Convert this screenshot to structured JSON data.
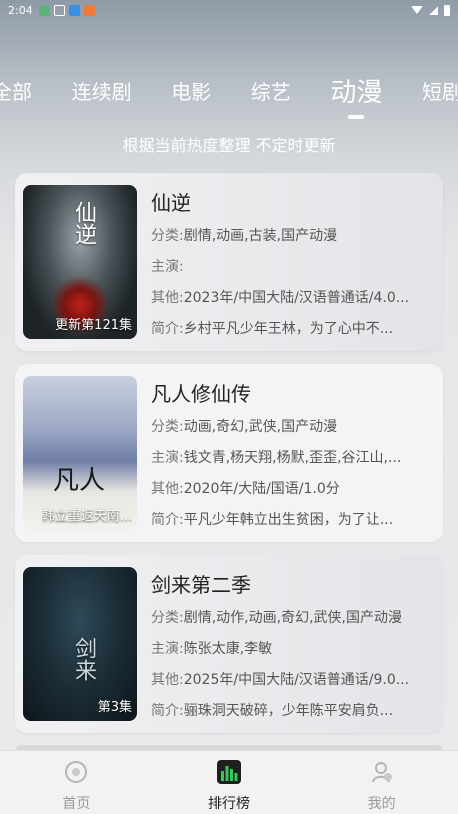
{
  "status": {
    "time": "2:04"
  },
  "tabs": [
    "全部",
    "连续剧",
    "电影",
    "综艺",
    "动漫",
    "短剧"
  ],
  "active_tab": "动漫",
  "subtitle": "根据当前热度整理 不定时更新",
  "labels": {
    "category": "分类:",
    "cast": "主演:",
    "other": "其他:",
    "summary": "简介:"
  },
  "items": [
    {
      "title": "仙逆",
      "poster_text": "仙逆",
      "badge": "更新第121集",
      "category": "剧情,动画,古装,国产动漫",
      "cast": "",
      "other": "2023年/中国大陆/汉语普通话/4.0...",
      "summary": "乡村平凡少年王林，为了心中不..."
    },
    {
      "title": "凡人修仙传",
      "poster_text": "凡人",
      "badge": "韩立重返天南...",
      "category": "动画,奇幻,武侠,国产动漫",
      "cast": "钱文青,杨天翔,杨默,歪歪,谷江山,...",
      "other": "2020年/大陆/国语/1.0分",
      "summary": "平凡少年韩立出生贫困，为了让..."
    },
    {
      "title": "剑来第二季",
      "poster_text": "剑来",
      "badge": "第3集",
      "category": "剧情,动作,动画,奇幻,武侠,国产动漫",
      "cast": "陈张太康,李敏",
      "other": "2025年/中国大陆/汉语普通话/9.0...",
      "summary": "骊珠洞天破碎，少年陈平安肩负..."
    }
  ],
  "nav": [
    {
      "label": "首页",
      "icon": "home-icon"
    },
    {
      "label": "排行榜",
      "icon": "ranking-icon"
    },
    {
      "label": "我的",
      "icon": "profile-icon"
    }
  ],
  "active_nav": "排行榜"
}
